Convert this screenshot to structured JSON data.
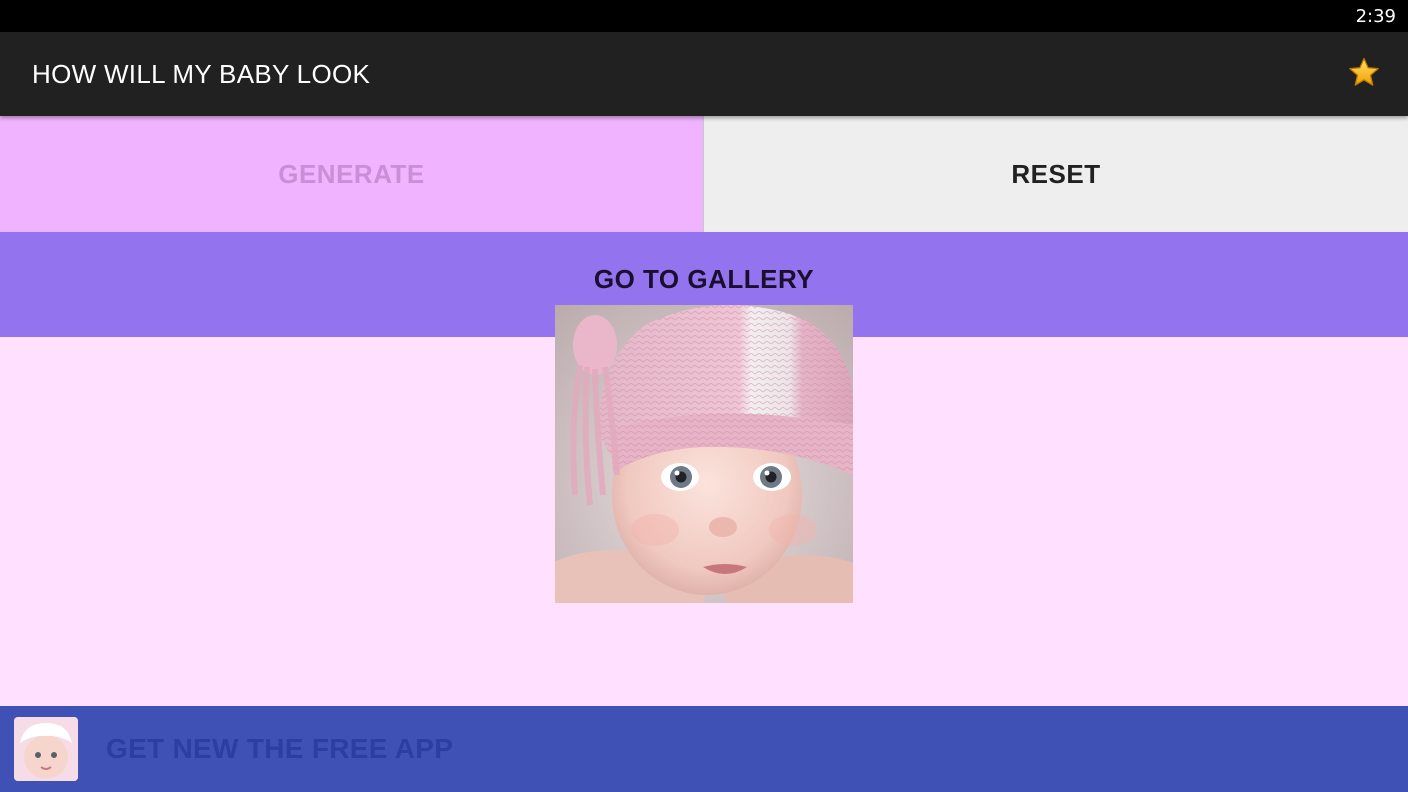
{
  "status_bar": {
    "time": "2:39"
  },
  "app_bar": {
    "title": "HOW WILL MY BABY LOOK",
    "favorite_icon": "star-icon"
  },
  "buttons": {
    "generate_label": "GENERATE",
    "reset_label": "RESET",
    "gallery_label": "GO TO GALLERY"
  },
  "ad_banner": {
    "text": "GET NEW THE FREE APP"
  },
  "colors": {
    "app_bar": "#212121",
    "generate_bg": "#f0b3ff",
    "reset_bg": "#eeeeee",
    "gallery_bg": "#9473ee",
    "content_bg": "#ffe0ff",
    "ad_bg": "#3f51b5",
    "star": "#f5b400"
  }
}
